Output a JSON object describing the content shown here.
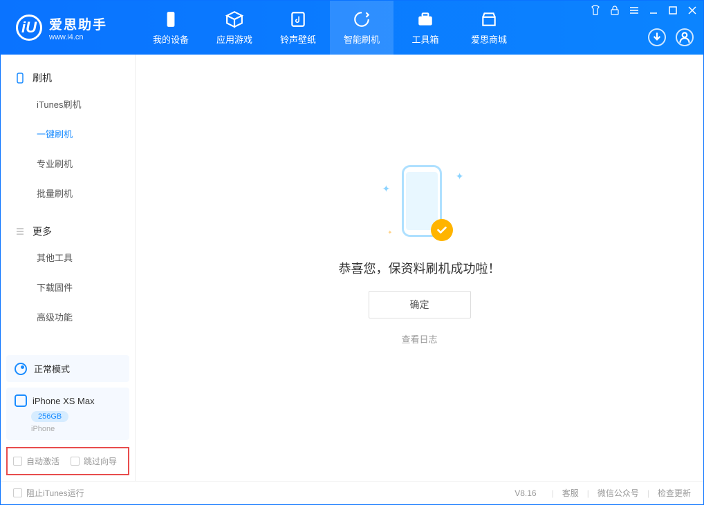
{
  "app": {
    "title": "爱思助手",
    "subtitle": "www.i4.cn"
  },
  "tabs": {
    "device": "我的设备",
    "apps": "应用游戏",
    "ringtone": "铃声壁纸",
    "flash": "智能刷机",
    "toolbox": "工具箱",
    "store": "爱思商城"
  },
  "sidebar": {
    "flash_header": "刷机",
    "items": {
      "itunes": "iTunes刷机",
      "oneclick": "一键刷机",
      "pro": "专业刷机",
      "batch": "批量刷机"
    },
    "more_header": "更多",
    "more": {
      "other": "其他工具",
      "firmware": "下载固件",
      "advanced": "高级功能"
    }
  },
  "mode": {
    "label": "正常模式"
  },
  "device": {
    "name": "iPhone XS Max",
    "capacity": "256GB",
    "type": "iPhone"
  },
  "options": {
    "auto_activate": "自动激活",
    "skip_guide": "跳过向导"
  },
  "result": {
    "message": "恭喜您，保资料刷机成功啦！",
    "confirm": "确定",
    "viewlog": "查看日志"
  },
  "status": {
    "block_itunes": "阻止iTunes运行",
    "version": "V8.16",
    "cs": "客服",
    "wechat": "微信公众号",
    "update": "检查更新"
  }
}
